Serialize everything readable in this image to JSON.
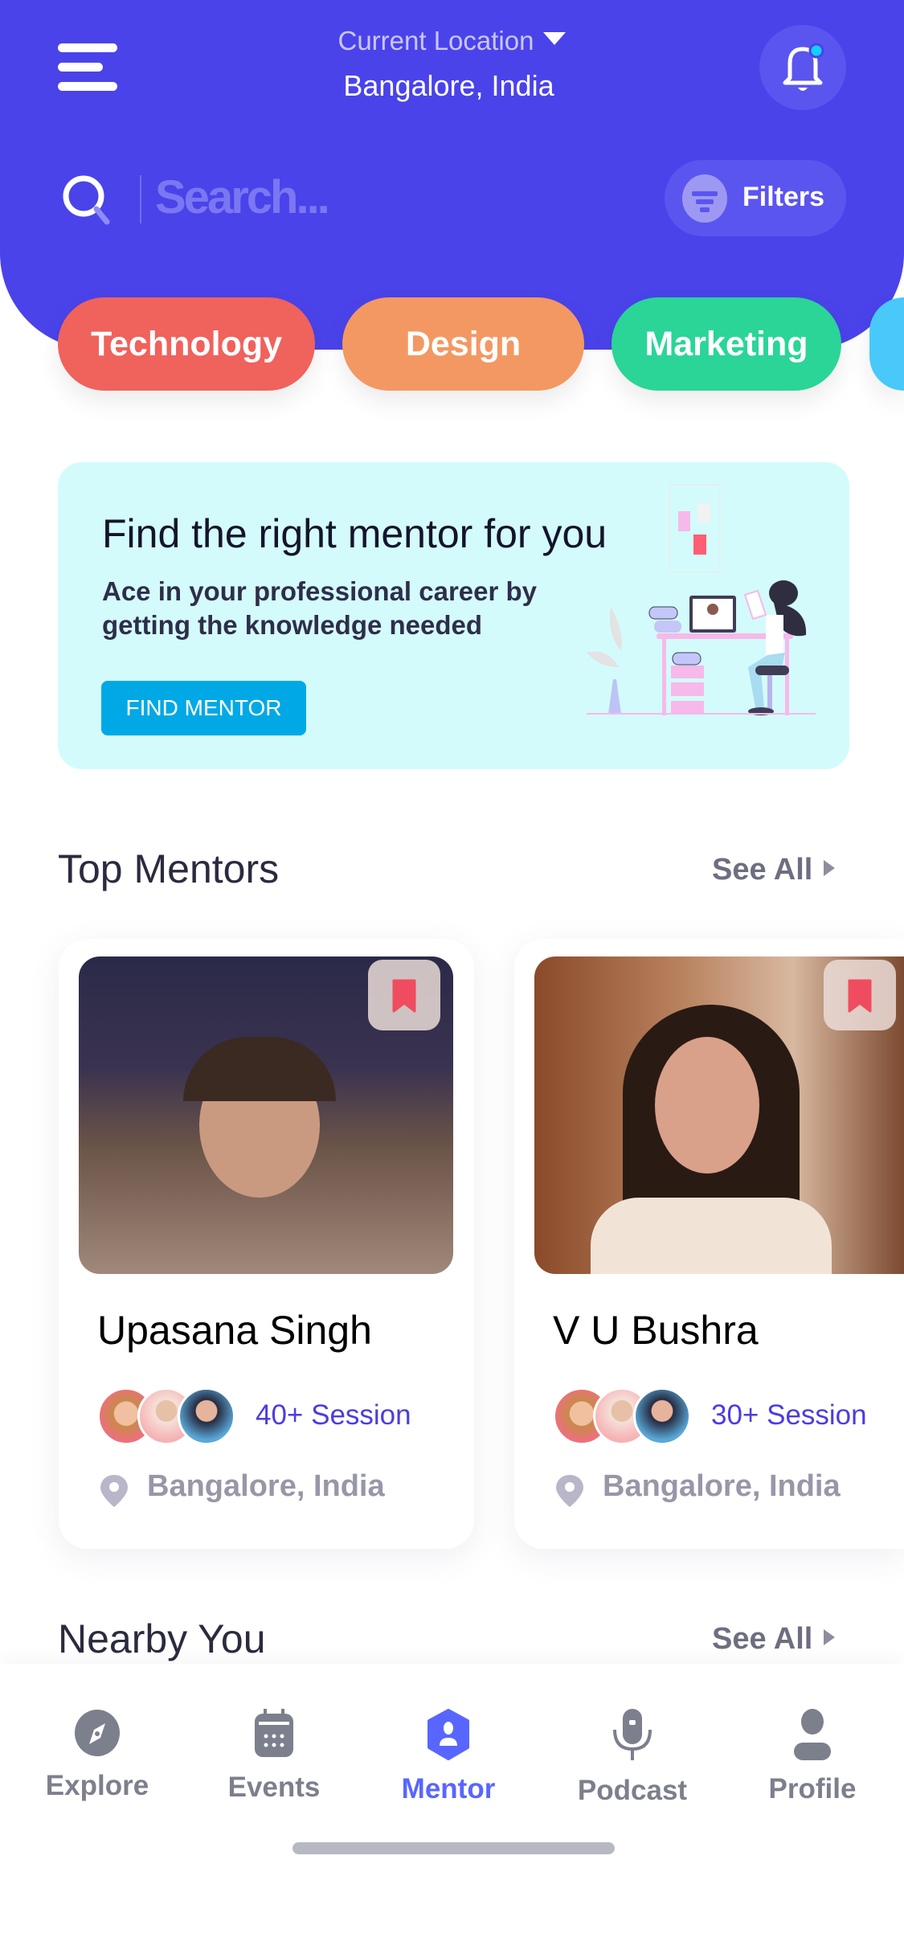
{
  "header": {
    "location_label": "Current Location",
    "location_value": "Bangalore, India",
    "search_placeholder": "Search...",
    "filters_label": "Filters",
    "brand_color": "#4a43ea"
  },
  "categories": [
    {
      "label": "Technology",
      "color": "#f0625c"
    },
    {
      "label": "Design",
      "color": "#f39862"
    },
    {
      "label": "Marketing",
      "color": "#2ad597"
    },
    {
      "label": "",
      "color": "#48c9fa"
    }
  ],
  "banner": {
    "title": "Find the right mentor for you",
    "subtitle": "Ace in your professional career by getting the knowledge needed",
    "button": "FIND MENTOR"
  },
  "top_mentors": {
    "title": "Top Mentors",
    "see_all": "See All",
    "mentors": [
      {
        "name": "Upasana Singh",
        "sessions": "40+ Session",
        "location": "Bangalore, India"
      },
      {
        "name": "V U Bushra",
        "sessions": "30+ Session",
        "location": "Bangalore, India"
      }
    ]
  },
  "nearby": {
    "title": "Nearby You",
    "see_all": "See All"
  },
  "nav": {
    "active": "Mentor",
    "items": [
      {
        "label": "Explore",
        "icon": "compass-icon"
      },
      {
        "label": "Events",
        "icon": "calendar-icon"
      },
      {
        "label": "Mentor",
        "icon": "mentor-icon"
      },
      {
        "label": "Podcast",
        "icon": "microphone-icon"
      },
      {
        "label": "Profile",
        "icon": "profile-icon"
      }
    ]
  }
}
